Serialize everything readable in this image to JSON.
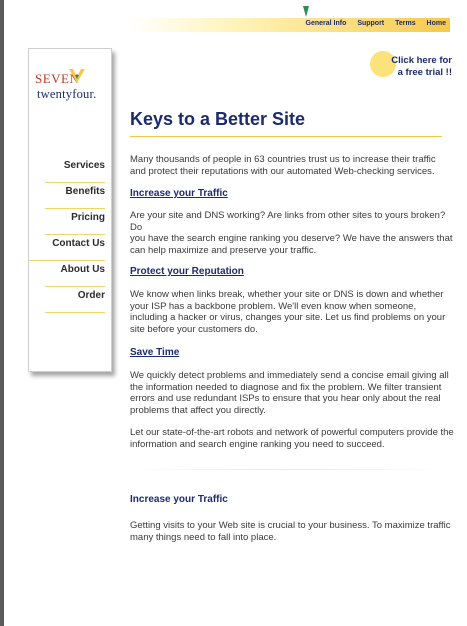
{
  "topnav": {
    "items": [
      "General Info",
      "Support",
      "Terms",
      "Home"
    ]
  },
  "trial": {
    "line1": "Click here for",
    "line2": "a free trial !!"
  },
  "logo": {
    "top": "SEVEN",
    "bottom": "twentyfour."
  },
  "sidebar": {
    "items": [
      "Services",
      "Benefits",
      "Pricing",
      "Contact Us",
      "About Us",
      "Order"
    ]
  },
  "main": {
    "title": "Keys to a Better Site",
    "intro": "Many thousands of people in 63 countries trust us to increase their traffic and protect their reputations with our automated Web-checking services.",
    "sections": [
      {
        "heading": "Increase your Traffic",
        "body": "Are your site and DNS working? Are links from other sites to yours broken? Do",
        "body2": "you have the search engine ranking you deserve? We have the answers that can help maximize and preserve your traffic."
      },
      {
        "heading": "Protect your Reputation",
        "body": "We know when links break, whether your site or DNS is down and whether your ISP has a backbone problem. We'll even know when someone, including a hacker or virus, changes your site. Let us find problems on your site before your customers do."
      },
      {
        "heading": "Save Time",
        "body": "We quickly detect problems and immediately send a concise email giving all the information needed to diagnose and fix the problem. We filter transient errors and use redundant ISPs to ensure that you hear only about the real problems that affect you directly.",
        "body2": "Let our state-of-the-art robots and network of powerful computers provide the information and search engine ranking you need to succeed."
      }
    ],
    "lower": {
      "heading": "Increase your Traffic",
      "body": "Getting visits to your Web site is crucial to your business. To maximize traffic many things need to fall into place."
    }
  },
  "colors": {
    "navy": "#1c2b6e",
    "gold": "#f6c94a",
    "red": "#c0392b",
    "green": "#2e8b57"
  }
}
